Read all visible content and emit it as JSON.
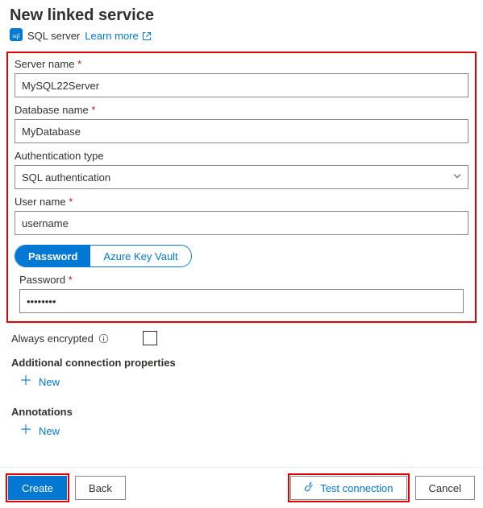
{
  "header": {
    "title": "New linked service",
    "service_type": "SQL server",
    "learn_more": "Learn more"
  },
  "fields": {
    "server_name": {
      "label": "Server name",
      "value": "MySQL22Server"
    },
    "database_name": {
      "label": "Database name",
      "value": "MyDatabase"
    },
    "auth_type": {
      "label": "Authentication type",
      "value": "SQL authentication"
    },
    "user_name": {
      "label": "User name",
      "value": "username"
    },
    "password_toggle": {
      "password": "Password",
      "akv": "Azure Key Vault"
    },
    "password": {
      "label": "Password",
      "value": "••••••••"
    }
  },
  "options": {
    "always_encrypted": "Always encrypted",
    "additional_props": "Additional connection properties",
    "annotations": "Annotations",
    "new": "New"
  },
  "footer": {
    "create": "Create",
    "back": "Back",
    "test": "Test connection",
    "cancel": "Cancel"
  }
}
